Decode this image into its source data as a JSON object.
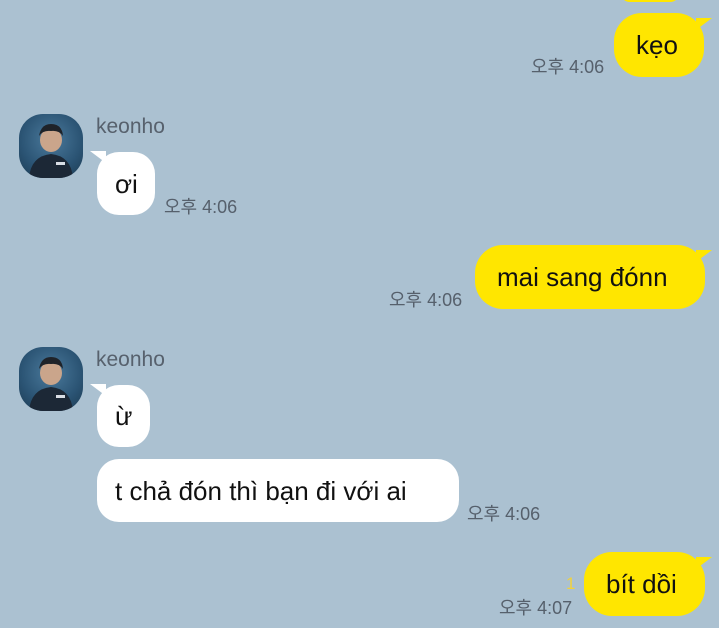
{
  "colors": {
    "background": "#abc1d1",
    "outgoing_bubble": "#ffe600",
    "incoming_bubble": "#ffffff",
    "timestamp": "#56606c",
    "unread_count": "#f1d23c"
  },
  "messages": [
    {
      "direction": "out",
      "text": "kẹo",
      "time": "오후 4:06"
    },
    {
      "direction": "in",
      "sender": "keonho",
      "avatar": "user-avatar-photo",
      "text": "ơi",
      "time": "오후 4:06"
    },
    {
      "direction": "out",
      "text": "mai sang đónn",
      "time": "오후 4:06"
    },
    {
      "direction": "in",
      "sender": "keonho",
      "avatar": "user-avatar-photo",
      "text": "ừ"
    },
    {
      "direction": "in",
      "text": "t chả đón thì bạn đi với ai",
      "time": "오후 4:06"
    },
    {
      "direction": "out",
      "text": "bít dồi",
      "time": "오후 4:07",
      "unread": "1"
    }
  ]
}
